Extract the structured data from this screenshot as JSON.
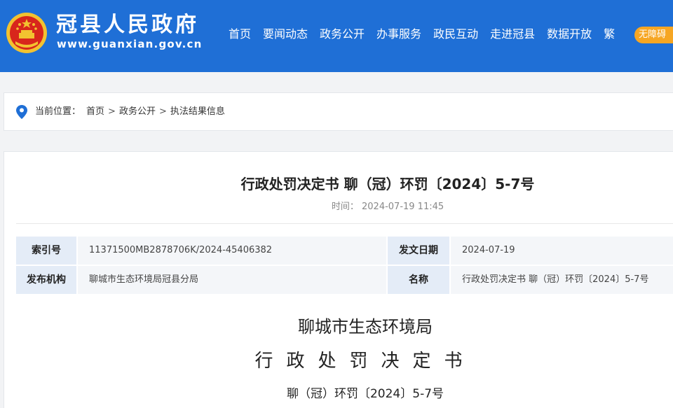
{
  "header": {
    "site_title": "冠县人民政府",
    "site_url": "www.guanxian.gov.cn",
    "nav": [
      "首页",
      "要闻动态",
      "政务公开",
      "办事服务",
      "政民互动",
      "走进冠县",
      "数据开放"
    ],
    "lang_toggle": "繁",
    "accessibility_label": "无障碍",
    "colors": {
      "header_bg": "#1f6fd6",
      "accent": "#f6a623"
    }
  },
  "breadcrumb": {
    "label": "当前位置：",
    "items": [
      "首页",
      "政务公开",
      "执法结果信息"
    ],
    "separator": ">"
  },
  "document": {
    "title": "行政处罚决定书 聊（冠）环罚〔2024〕5-7号",
    "time_label": "时间：",
    "time_value": "2024-07-19 11:45",
    "info": {
      "index_label": "索引号",
      "index_value": "11371500MB2878706K/2024-45406382",
      "date_label": "发文日期",
      "date_value": "2024-07-19",
      "publisher_label": "发布机构",
      "publisher_value": "聊城市生态环境局冠县分局",
      "name_label": "名称",
      "name_value": "行政处罚决定书 聊（冠）环罚〔2024〕5-7号"
    },
    "body": {
      "org": "聊城市生态环境局",
      "heading": "行政处罚决定书",
      "number": "聊（冠）环罚〔2024〕5-7号"
    }
  }
}
